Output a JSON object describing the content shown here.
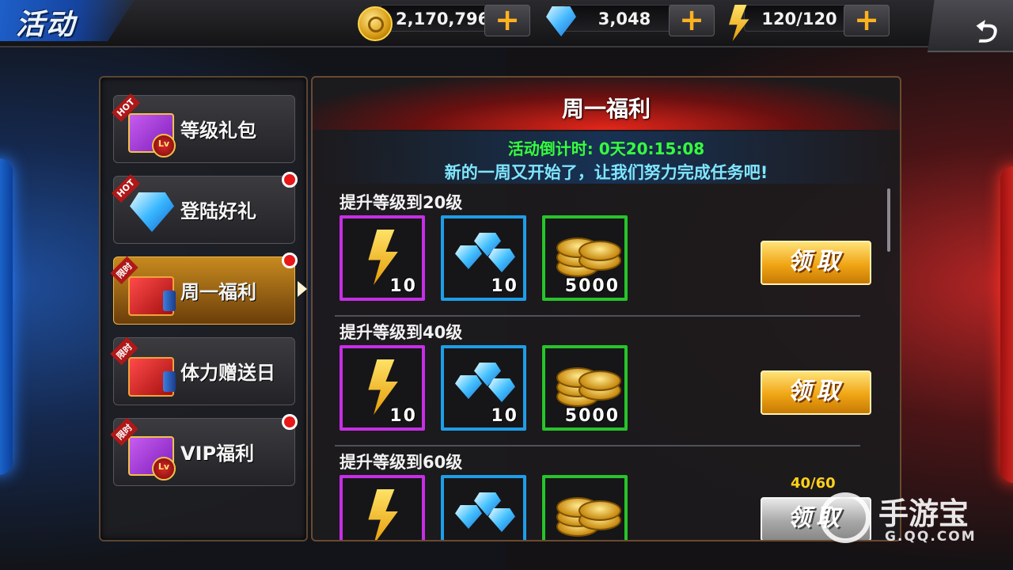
{
  "header": {
    "title": "活动",
    "resources": [
      {
        "icon": "gold-coin-icon",
        "value": "2,170,796"
      },
      {
        "icon": "diamond-icon",
        "value": "3,048"
      },
      {
        "icon": "energy-bolt-icon",
        "value": "120/120"
      }
    ],
    "back_icon": "back-arrow-icon"
  },
  "sidebar": {
    "items": [
      {
        "label": "等级礼包",
        "tag": "HOT",
        "icon": "level-gift-box-icon",
        "badge": false,
        "active": false
      },
      {
        "label": "登陆好礼",
        "tag": "HOT",
        "icon": "diamond-icon",
        "badge": true,
        "active": false
      },
      {
        "label": "周一福利",
        "tag": "限时",
        "icon": "drink-gift-box-icon",
        "badge": true,
        "active": true
      },
      {
        "label": "体力赠送日",
        "tag": "限时",
        "icon": "drink-gift-box-icon",
        "badge": false,
        "active": false
      },
      {
        "label": "VIP福利",
        "tag": "限时",
        "icon": "level-gift-box-icon",
        "badge": true,
        "active": false
      }
    ]
  },
  "main": {
    "title": "周一福利",
    "countdown": "活动倒计时: 0天20:15:08",
    "subtitle": "新的一周又开始了，让我们努力完成任务吧!",
    "tasks": [
      {
        "title": "提升等级到20级",
        "rewards": [
          {
            "type": "energy",
            "qty": "10"
          },
          {
            "type": "diamond",
            "qty": "10"
          },
          {
            "type": "gold",
            "qty": "5000"
          }
        ],
        "claim_label": "领取",
        "progress": ""
      },
      {
        "title": "提升等级到40级",
        "rewards": [
          {
            "type": "energy",
            "qty": "10"
          },
          {
            "type": "diamond",
            "qty": "10"
          },
          {
            "type": "gold",
            "qty": "5000"
          }
        ],
        "claim_label": "领取",
        "progress": ""
      },
      {
        "title": "提升等级到60级",
        "rewards": [
          {
            "type": "energy",
            "qty": ""
          },
          {
            "type": "diamond",
            "qty": ""
          },
          {
            "type": "gold",
            "qty": ""
          }
        ],
        "claim_label": "领取",
        "progress": "40/60"
      }
    ]
  },
  "watermark": {
    "text": "手游宝",
    "url": "G.QQ.COM"
  },
  "colors": {
    "accent_gold": "#f0a514",
    "countdown_green": "#36ff3e",
    "subtitle_cyan": "#7fe6ff",
    "badge_red": "#e81818"
  }
}
